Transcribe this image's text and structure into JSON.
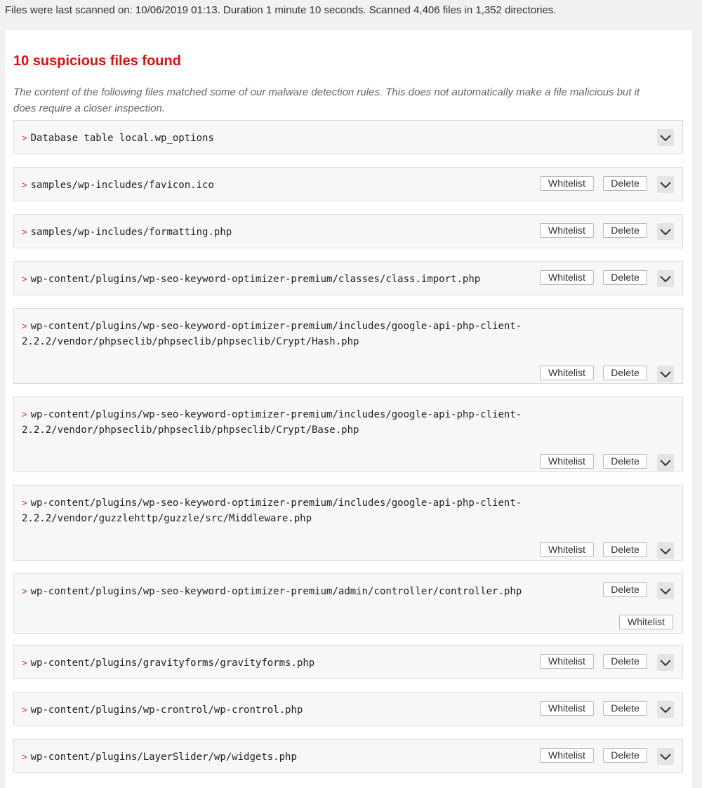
{
  "scan_info": "Files were last scanned on: 10/06/2019 01:13. Duration 1 minute 10 seconds. Scanned 4,406 files in 1,352 directories.",
  "heading": "10 suspicious files found",
  "description": "The content of the following files matched some of our malware detection rules. This does not automatically make a file malicious but it does require a closer inspection.",
  "colors": {
    "heading": "#dc1010",
    "arrow": "#e01c1c"
  },
  "icons": {
    "row_marker": "chevron-right-icon",
    "toggle": "chevron-down-icon"
  },
  "labels": {
    "whitelist": "Whitelist",
    "delete": "Delete"
  },
  "files": [
    {
      "path": "Database table local.wp_options"
    },
    {
      "path": "samples/wp-includes/favicon.ico"
    },
    {
      "path": "samples/wp-includes/formatting.php"
    },
    {
      "path": "wp-content/plugins/wp-seo-keyword-optimizer-premium/classes/class.import.php"
    },
    {
      "path": "wp-content/plugins/wp-seo-keyword-optimizer-premium/includes/google-api-php-client-\n2.2.2/vendor/phpseclib/phpseclib/phpseclib/Crypt/Hash.php"
    },
    {
      "path": "wp-content/plugins/wp-seo-keyword-optimizer-premium/includes/google-api-php-client-\n2.2.2/vendor/phpseclib/phpseclib/phpseclib/Crypt/Base.php"
    },
    {
      "path": "wp-content/plugins/wp-seo-keyword-optimizer-premium/includes/google-api-php-client-\n2.2.2/vendor/guzzlehttp/guzzle/src/Middleware.php"
    },
    {
      "path": "wp-content/plugins/wp-seo-keyword-optimizer-premium/admin/controller/controller.php"
    },
    {
      "path": "wp-content/plugins/gravityforms/gravityforms.php"
    },
    {
      "path": "wp-content/plugins/wp-crontrol/wp-crontrol.php"
    },
    {
      "path": "wp-content/plugins/LayerSlider/wp/widgets.php"
    }
  ]
}
